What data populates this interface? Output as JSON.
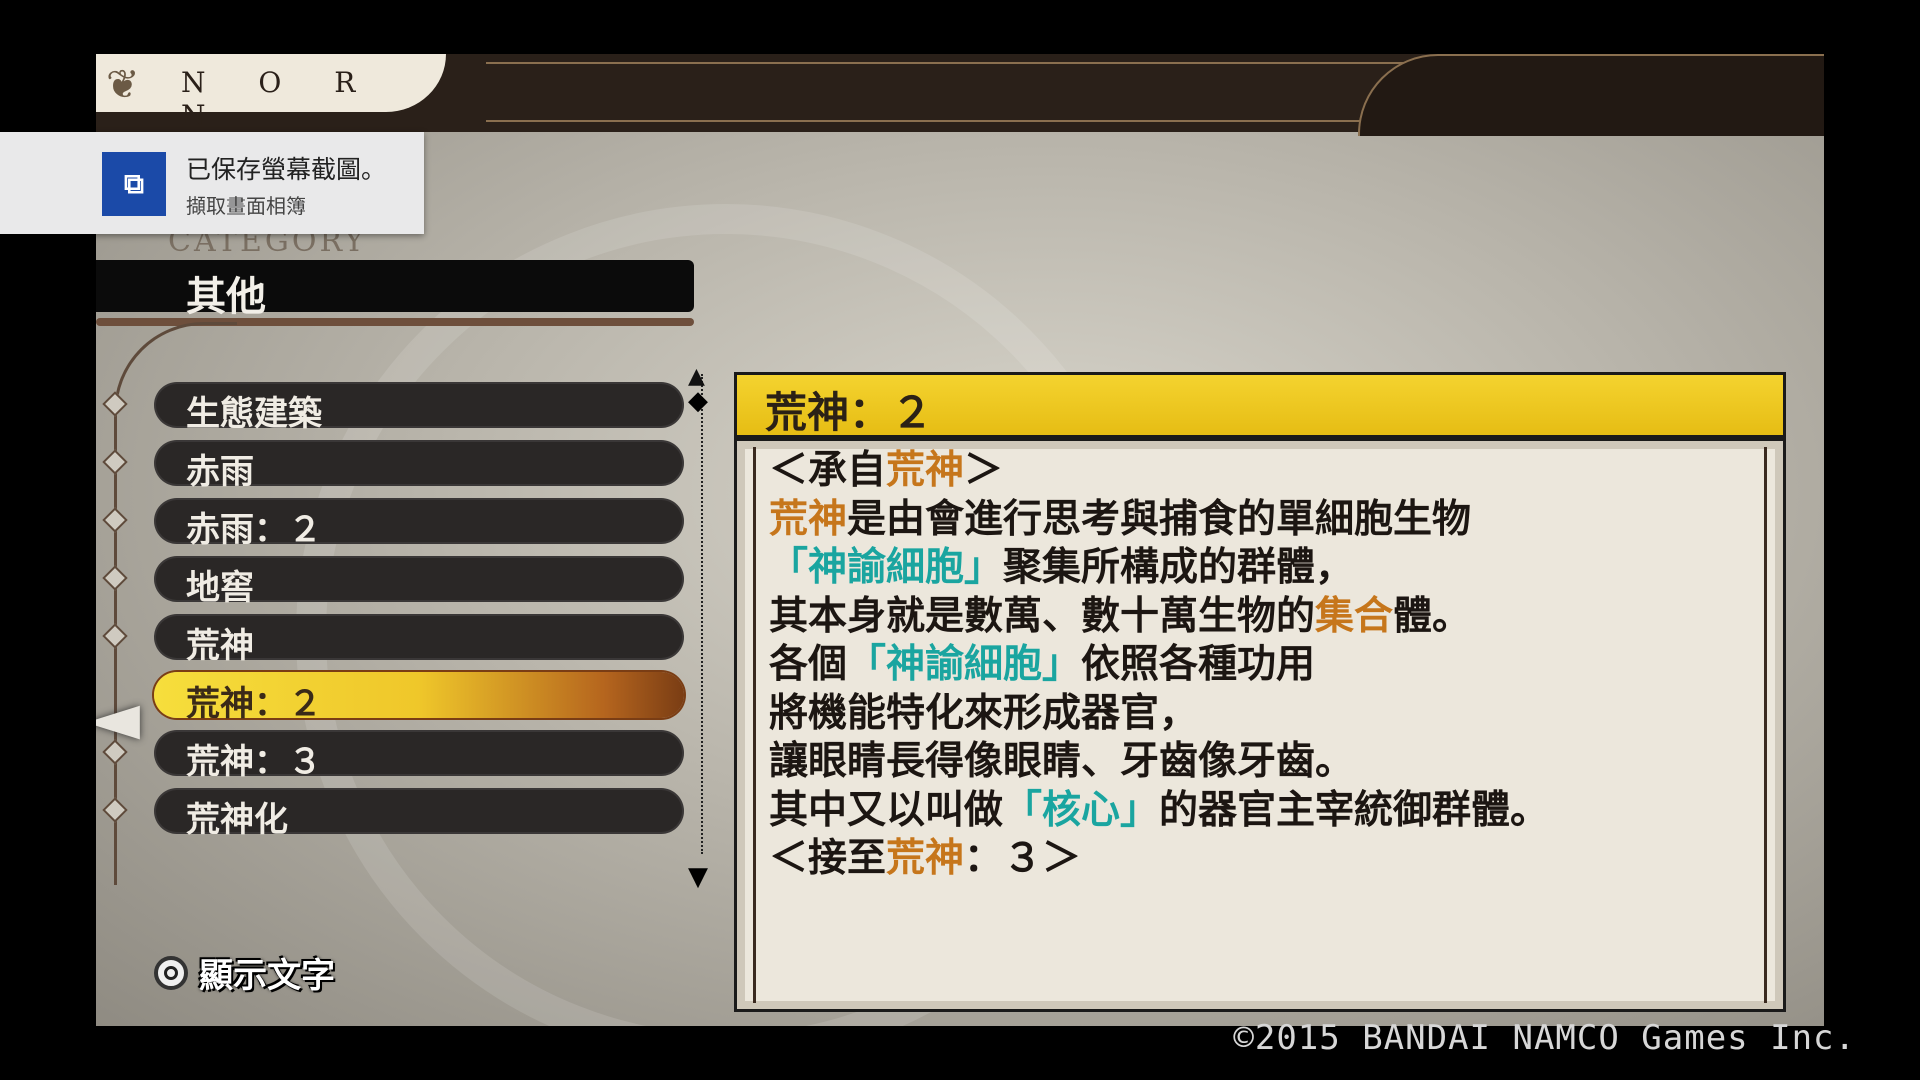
{
  "header": {
    "title": "N O R N",
    "leaf_icon": "fleur-leaf-icon"
  },
  "notification": {
    "icon": "playstation-share-icon",
    "title": "已保存螢幕截圖。",
    "subtitle": "擷取畫面相簿"
  },
  "category": {
    "label": "CATEGORY",
    "value": "其他"
  },
  "list": {
    "items": [
      {
        "label": "生態建築",
        "selected": false
      },
      {
        "label": "赤雨",
        "selected": false
      },
      {
        "label": "赤雨：２",
        "selected": false
      },
      {
        "label": "地窖",
        "selected": false
      },
      {
        "label": "荒神",
        "selected": false
      },
      {
        "label": "荒神：２",
        "selected": true
      },
      {
        "label": "荒神：３",
        "selected": false
      },
      {
        "label": "荒神化",
        "selected": false
      }
    ]
  },
  "detail": {
    "title": "荒神：２",
    "lines": [
      [
        {
          "t": "＜承自"
        },
        {
          "t": "荒神",
          "c": "orange"
        },
        {
          "t": "＞"
        }
      ],
      [
        {
          "t": "荒神",
          "c": "orange"
        },
        {
          "t": "是由會進行思考與捕食的單細胞生物"
        }
      ],
      [
        {
          "t": "「神諭細胞」",
          "c": "teal"
        },
        {
          "t": "聚集所構成的群體，"
        }
      ],
      [
        {
          "t": "其本身就是數萬、數十萬生物的"
        },
        {
          "t": "集合",
          "c": "orange"
        },
        {
          "t": "體。"
        }
      ],
      [
        {
          "t": "各個"
        },
        {
          "t": "「神諭細胞」",
          "c": "teal"
        },
        {
          "t": "依照各種功用"
        }
      ],
      [
        {
          "t": "將機能特化來形成器官，"
        }
      ],
      [
        {
          "t": "讓眼睛長得像眼睛、牙齒像牙齒。"
        }
      ],
      [
        {
          "t": "其中又以叫做"
        },
        {
          "t": "「核心」",
          "c": "teal"
        },
        {
          "t": "的器官主宰統御群體。"
        }
      ],
      [
        {
          "t": "＜接至"
        },
        {
          "t": "荒神",
          "c": "orange"
        },
        {
          "t": "：３＞"
        }
      ]
    ]
  },
  "prompt": {
    "button_icon": "circle-button-icon",
    "label": "顯示文字"
  },
  "copyright": "©2015 BANDAI NAMCO Games Inc.",
  "colors": {
    "highlight_orange": "#c6761b",
    "highlight_teal": "#1aa5a0",
    "title_bar": "#f4d32f"
  }
}
